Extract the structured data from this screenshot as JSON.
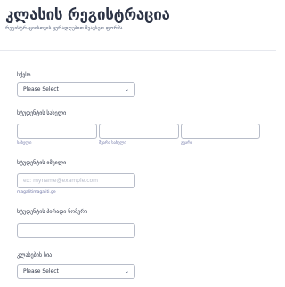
{
  "form": {
    "title": "კლასის რეგისტრაცია",
    "subtitle": "რეგისტრაციისთვის ყურადღებით შეავსეთ ფორმა"
  },
  "fields": {
    "class": {
      "label": "სქესი",
      "selected": "Please Select"
    },
    "student_name": {
      "label": "სტუდენტის სახელი",
      "first_label": "სახელი",
      "middle_label": "შუარა სახელი",
      "last_label": "გვარი"
    },
    "student_email": {
      "label": "სტუდენტის იმეილი",
      "placeholder": "ex: myname@example.com",
      "hint": "magalitimagaliti.ge"
    },
    "student_id": {
      "label": "სტუდენტის პირადი ნომერი"
    },
    "class_list": {
      "label": "კლასების სია",
      "selected": "Please Select"
    }
  },
  "icons": {
    "dropdown": "chevron-down-icon"
  }
}
